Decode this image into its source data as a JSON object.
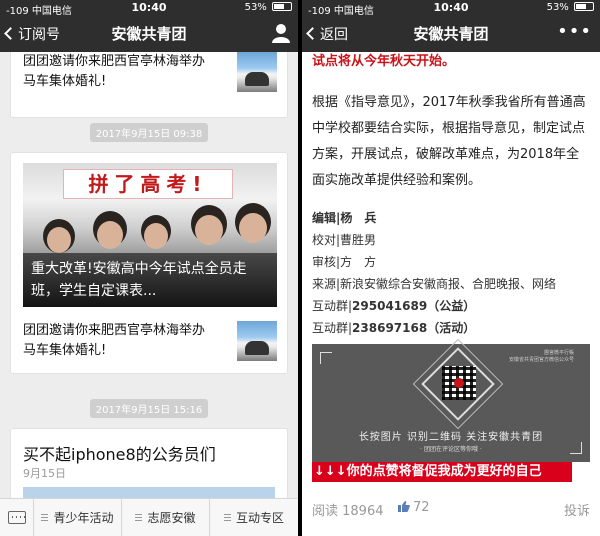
{
  "status": {
    "carrier": "-109 中国电信",
    "time": "10:40",
    "battery": "53%"
  },
  "left": {
    "back_label": "订阅号",
    "title": "安徽共青团",
    "top_article": "团团邀请你来肥西官亭林海举办马车集体婚礼!",
    "date1": "2017年9月15日 09:38",
    "hero_banner": "拼了高考!",
    "hero_caption": "重大改革!安徽高中今年试点全员走班，学生自定课表...",
    "article2": "团团邀请你来肥西官亭林海举办马车集体婚礼!",
    "date2": "2017年9月15日 15:16",
    "article3_title": "买不起iphone8的公务员们",
    "article3_date": "9月15日",
    "menu": [
      "青少年活动",
      "志愿安徽",
      "互动专区"
    ]
  },
  "right": {
    "back_label": "返回",
    "title": "安徽共青团",
    "red_top": "试点将从今年秋天开始。",
    "paragraph": "根据《指导意见》，2017年秋季我省所有普通高中学校都要结合实际，根据指导意见，制定试点方案，开展试点，破解改革难点，为2018年全面实施改革提供经验和案例。",
    "editor": "编辑|杨　兵",
    "proof": "校对|曹胜男",
    "review": "审核|方　方",
    "source": "来源|新浪安徽综合安徽商报、合肥晚报、网络",
    "group1_prefix": "互动群|",
    "group1": "295041689（公益）",
    "group2_prefix": "互动群|",
    "group2": "238697168（活动）",
    "qr_small": [
      "團官微平行帳",
      "安徽省共青团官方微信公众号"
    ],
    "qr_line1": "长按图片  识别二维码  关注安徽共青团",
    "qr_line2": "· 团团在评论区等你哦 ·",
    "red_bar": "↓↓↓你的点赞将督促我成为更好的自己",
    "reads": "阅读 18964",
    "likes": "72",
    "report": "投诉"
  }
}
